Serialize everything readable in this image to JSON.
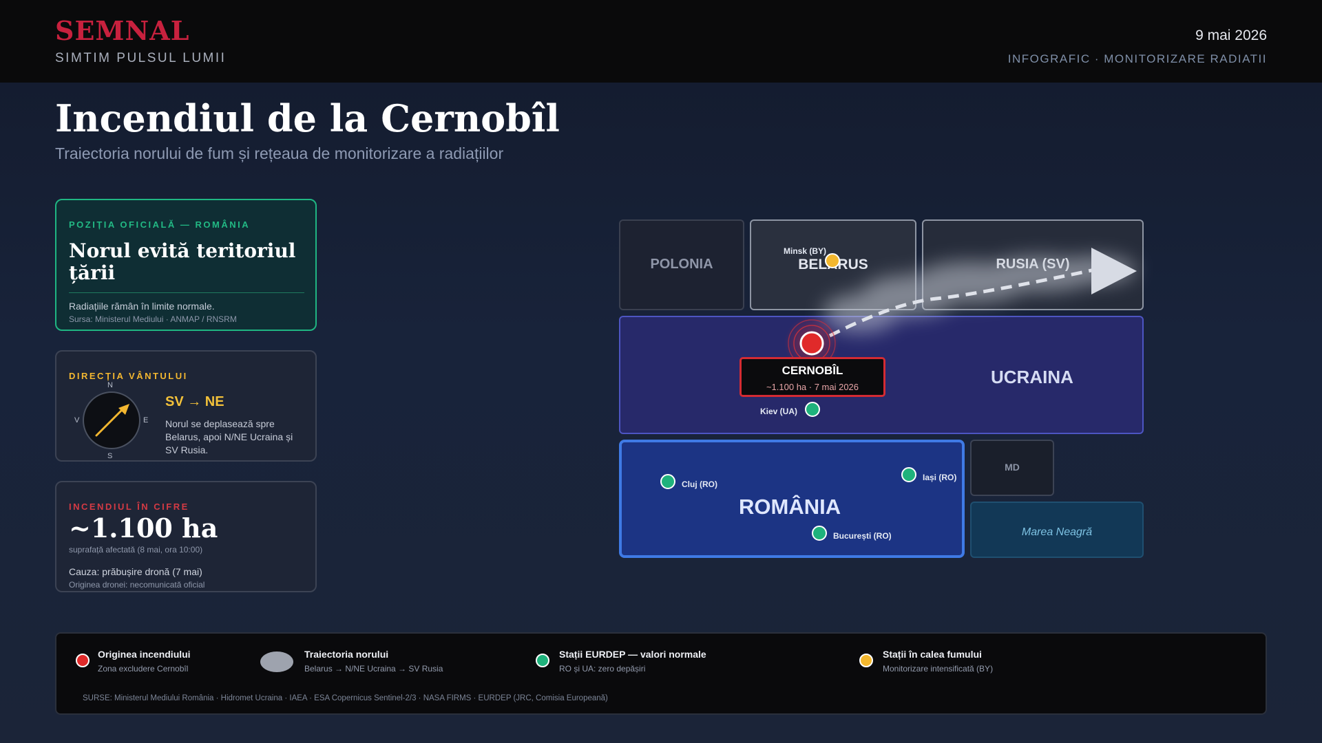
{
  "header": {
    "brand": "SEMNAL",
    "tagline": "SIMTIM PULSUL LUMII",
    "date": "9 mai 2026",
    "section": "INFOGRAFIC · MONITORIZARE RADIATII"
  },
  "title": "Incendiul de la Cernobîl",
  "subtitle": "Traiectoria norului de fum și rețeaua de monitorizare a radiațiilor",
  "official_card": {
    "label": "POZIȚIA OFICIALĂ — ROMÂNIA",
    "headline": "Norul evită teritoriul țării",
    "text": "Radiațiile rămân în limite normale.",
    "source": "Sursa: Ministerul Mediului · ANMAP / RNSRM"
  },
  "wind_card": {
    "label": "DIRECȚIA VÂNTULUI",
    "compass": {
      "n": "N",
      "s": "S",
      "e": "E",
      "w": "V"
    },
    "direction": "SV → NE",
    "text": "Norul se deplasează spre Belarus, apoi N/NE Ucraina și SV Rusia."
  },
  "figures_card": {
    "label": "INCENDIUL ÎN CIFRE",
    "area": "~1.100 ha",
    "area_note": "suprafață afectată (8 mai, ora 10:00)",
    "cause": "Cauza: prăbușire dronă (7 mai)",
    "drone_origin": "Originea dronei: necomunicată oficial"
  },
  "map": {
    "countries": {
      "poland": "POLONIA",
      "belarus": "BELARUS",
      "russia": "RUSIA (SV)",
      "ukraine": "UCRAINA",
      "romania": "ROMÂNIA",
      "moldova": "MD",
      "black_sea": "Marea Neagră"
    },
    "fire": {
      "name": "CERNOBÎL",
      "detail": "~1.100 ha · 7 mai 2026"
    },
    "stations": {
      "minsk": "Minsk (BY)",
      "kiev": "Kiev (UA)",
      "cluj": "Cluj (RO)",
      "iasi": "Iași (RO)",
      "bucuresti": "București (RO)"
    }
  },
  "legend": {
    "items": [
      {
        "title": "Originea incendiului",
        "desc": "Zona excludere Cernobîl"
      },
      {
        "title": "Traiectoria norului",
        "desc": "Belarus → N/NE Ucraina → SV Rusia"
      },
      {
        "title": "Stații EURDEP — valori normale",
        "desc": "RO și UA: zero depășiri"
      },
      {
        "title": "Stații în calea fumului",
        "desc": "Monitorizare intensificată (BY)"
      }
    ],
    "sources": "SURSE: Ministerul Mediului România · Hidromet Ucraina · IAEA · ESA Copernicus Sentinel-2/3 · NASA FIRMS · EURDEP (JRC, Comisia Europeană)"
  },
  "colors": {
    "brand": "#c8213e",
    "fire": "#e02a2a",
    "normal_station": "#1fb27c",
    "watch_station": "#f3b72e",
    "ukraine": "#27296a",
    "romania": "#1c3484"
  }
}
